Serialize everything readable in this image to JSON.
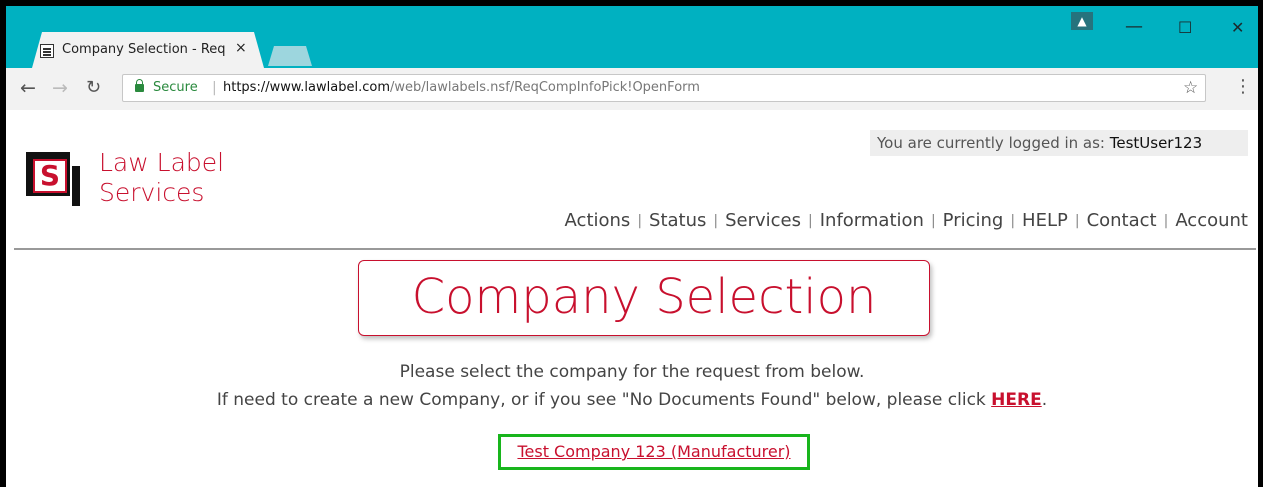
{
  "browser": {
    "tab_title": "Company Selection - Req",
    "tab_close": "×",
    "secure_label": "Secure",
    "url_host": "https://www.lawlabel.com",
    "url_path": "/web/lawlabels.nsf/ReqCompInfoPick!OpenForm",
    "window_buttons": {
      "minimize": "—",
      "maximize": "☐",
      "close": "✕"
    }
  },
  "site": {
    "brand_line1": "Law Label",
    "brand_line2": "Services",
    "logo_letter": "S",
    "logged_in_prefix": "You are currently logged in as: ",
    "logged_in_user": "TestUser123",
    "nav": [
      "Actions",
      "Status",
      "Services",
      "Information",
      "Pricing",
      "HELP",
      "Contact",
      "Account"
    ],
    "nav_separator": "|"
  },
  "main": {
    "heading": "Company Selection",
    "instruction_line1": "Please select the company for the request from below.",
    "instruction_line2": "If need to create a new Company, or if you see \"No Documents Found\" below, please click ",
    "here_link": "HERE",
    "instruction_line2_end": ".",
    "company_link": "Test Company 123 (Manufacturer)"
  },
  "colors": {
    "brand_red": "#c8102e",
    "browser_teal": "#00b1c1",
    "highlight_green": "#18b51c"
  }
}
